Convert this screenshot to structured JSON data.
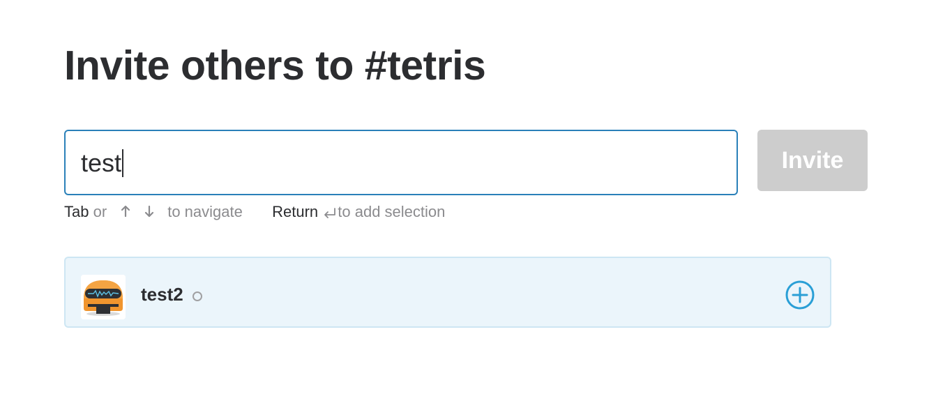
{
  "header": {
    "title": "Invite others to #tetris"
  },
  "search": {
    "value": "test"
  },
  "invite_button": {
    "label": "Invite"
  },
  "hint": {
    "tab_key": "Tab",
    "or_text": "or",
    "navigate_text": "to navigate",
    "return_key": "Return",
    "add_text": "to add selection",
    "icons": [
      "arrow-up-icon",
      "arrow-down-icon",
      "return-icon"
    ]
  },
  "results": [
    {
      "name": "test2",
      "presence": "away",
      "avatar_icon": "robot-avatar-icon",
      "action_icon": "add-circle-icon"
    }
  ],
  "colors": {
    "focus_border": "#2a80b9",
    "invite_disabled_bg": "#cdcdcd",
    "result_bg": "#ebf5fb",
    "result_border": "#cde6f3",
    "add_icon": "#2a9fd6",
    "avatar_orange": "#f0952e"
  }
}
